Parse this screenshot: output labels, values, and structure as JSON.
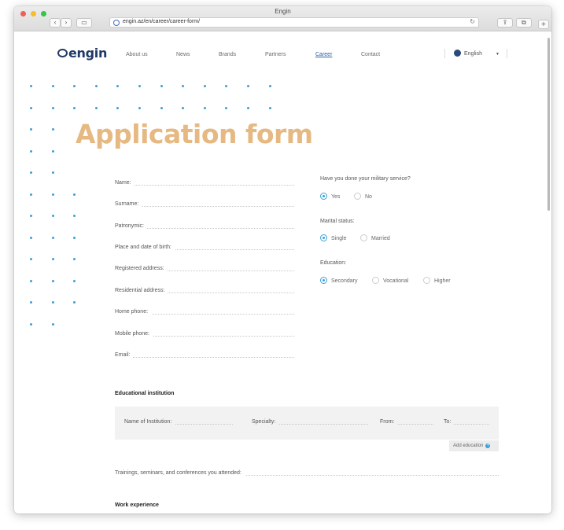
{
  "browser": {
    "window_title": "Engin",
    "url": "engin.az/en/career/career-form/",
    "back_glyph": "‹",
    "forward_glyph": "›",
    "sidebar_glyph": "▭",
    "share_glyph": "⇪",
    "tabs_glyph": "⧉",
    "newtab_glyph": "+",
    "reload_glyph": "↻"
  },
  "site": {
    "logo_text": "engin",
    "nav": [
      "About us",
      "News",
      "Brands",
      "Partners",
      "Career",
      "Contact"
    ],
    "active_nav": "Career",
    "language": "English",
    "caret": "▼"
  },
  "page": {
    "title": "Application form"
  },
  "form": {
    "fields": [
      "Name:",
      "Surname:",
      "Patronymic:",
      "Place and date of birth:",
      "Registered address:",
      "Residential address:",
      "Home phone:",
      "Mobile phone:",
      "Email:"
    ],
    "military": {
      "question": "Have you done your military service?",
      "options": [
        "Yes",
        "No"
      ],
      "selected": "Yes"
    },
    "marital": {
      "question": "Marital status:",
      "options": [
        "Single",
        "Married"
      ],
      "selected": "Single"
    },
    "education": {
      "question": "Education:",
      "options": [
        "Secondary",
        "Vocational",
        "Higher"
      ],
      "selected": "Secondary"
    },
    "educational_institution": {
      "title": "Educational institution",
      "fields": [
        "Name of Institution:",
        "Specialty:",
        "From:",
        "To:"
      ],
      "add_label": "Add education",
      "add_glyph": "+"
    },
    "trainings_label": "Trainings, seminars, and conferences you attended:",
    "work_experience_title": "Work experience"
  },
  "colors": {
    "accent": "#3aa0d8",
    "title": "#e6b982",
    "logo": "#1f3a68"
  }
}
